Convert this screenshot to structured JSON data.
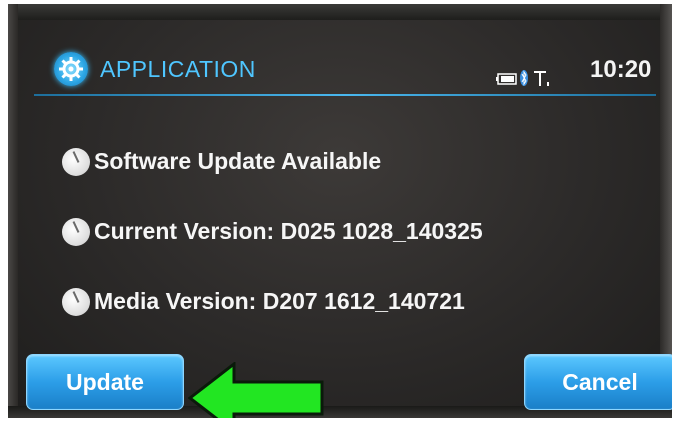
{
  "header": {
    "title": "APPLICATION",
    "clock": "10:20",
    "icons": [
      "settings-gear-icon",
      "battery-icon",
      "bluetooth-icon",
      "signal-icon"
    ]
  },
  "info": {
    "line1": "Software Update Available",
    "line2": "Current Version: D025 1028_140325",
    "line3": "Media Version: D207 1612_140721"
  },
  "buttons": {
    "update": "Update",
    "cancel": "Cancel"
  },
  "annotation": {
    "arrow_color": "#22e622",
    "arrow_direction": "left"
  },
  "colors": {
    "accent": "#4fc6ff",
    "button": "#2c9ee8",
    "screen_bg": "#2c2a29"
  }
}
